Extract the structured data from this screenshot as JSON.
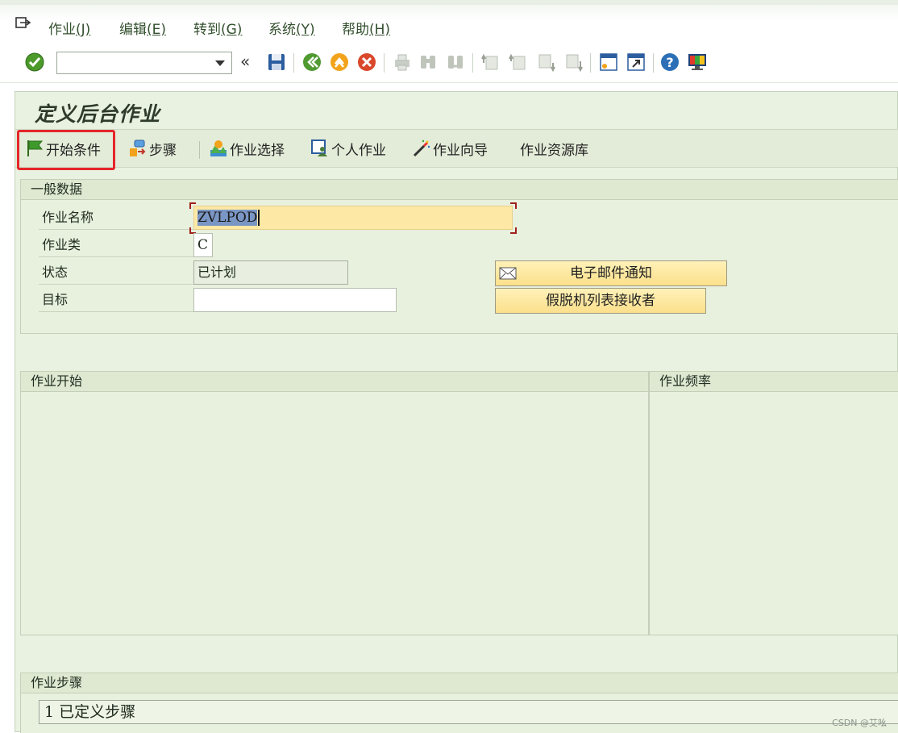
{
  "menu": {
    "items": [
      {
        "label": "作业",
        "accel": "(J)"
      },
      {
        "label": "编辑",
        "accel": "(E)"
      },
      {
        "label": "转到",
        "accel": "(G)"
      },
      {
        "label": "系统",
        "accel": "(Y)"
      },
      {
        "label": "帮助",
        "accel": "(H)"
      }
    ]
  },
  "toolbar": {
    "command_value": "",
    "icons": [
      "enter-icon",
      "back-double-icon",
      "save-icon",
      "back-icon",
      "exit-icon",
      "cancel-icon",
      "print-icon",
      "find-icon",
      "find-next-icon",
      "first-page-icon",
      "prev-page-icon",
      "next-page-icon",
      "last-page-icon",
      "new-session-icon",
      "shortcut-icon",
      "help-icon",
      "layout-icon"
    ]
  },
  "title": "定义后台作业",
  "app_toolbar": {
    "start_condition": "开始条件",
    "steps": "步骤",
    "job_selection": "作业选择",
    "own_jobs": "个人作业",
    "job_wizard": "作业向导",
    "job_repository": "作业资源库"
  },
  "general": {
    "header": "一般数据",
    "job_name_label": "作业名称",
    "job_name_value": "ZVLPOD",
    "job_class_label": "作业类",
    "job_class_value": "C",
    "status_label": "状态",
    "status_value": "已计划",
    "target_label": "目标",
    "target_value": "",
    "email_button": "电子邮件通知",
    "spool_button": "假脱机列表接收者"
  },
  "job_start": {
    "header": "作业开始"
  },
  "job_frequency": {
    "header": "作业频率"
  },
  "job_steps": {
    "header": "作业步骤",
    "summary": "1 已定义步骤"
  },
  "watermark": "CSDN @艾吆",
  "colors": {
    "highlight": "#e5262a",
    "button_yellow": "#fbe08c",
    "panel_green": "#e8f0de"
  }
}
